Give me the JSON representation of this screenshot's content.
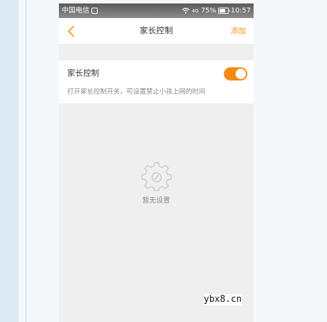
{
  "status_bar": {
    "carrier": "中国电信",
    "sim_icon": "sim-icon",
    "wifi_icon": "wifi-icon",
    "signal_label": "4G",
    "battery_percent": "75%",
    "battery_level": 0.75,
    "time": "10:57"
  },
  "nav": {
    "back_icon": "chevron-left-icon",
    "title": "家长控制",
    "add_label": "添加",
    "accent_color": "#f39515"
  },
  "parental_control": {
    "title": "家长控制",
    "description": "打开家长控制开关，可设置禁止小孩上网的时间",
    "enabled": true,
    "toggle_color": "#f38a13"
  },
  "empty_state": {
    "icon": "gear-icon",
    "text": "暂无设置"
  },
  "watermark": {
    "text": "ybx8.cn"
  }
}
